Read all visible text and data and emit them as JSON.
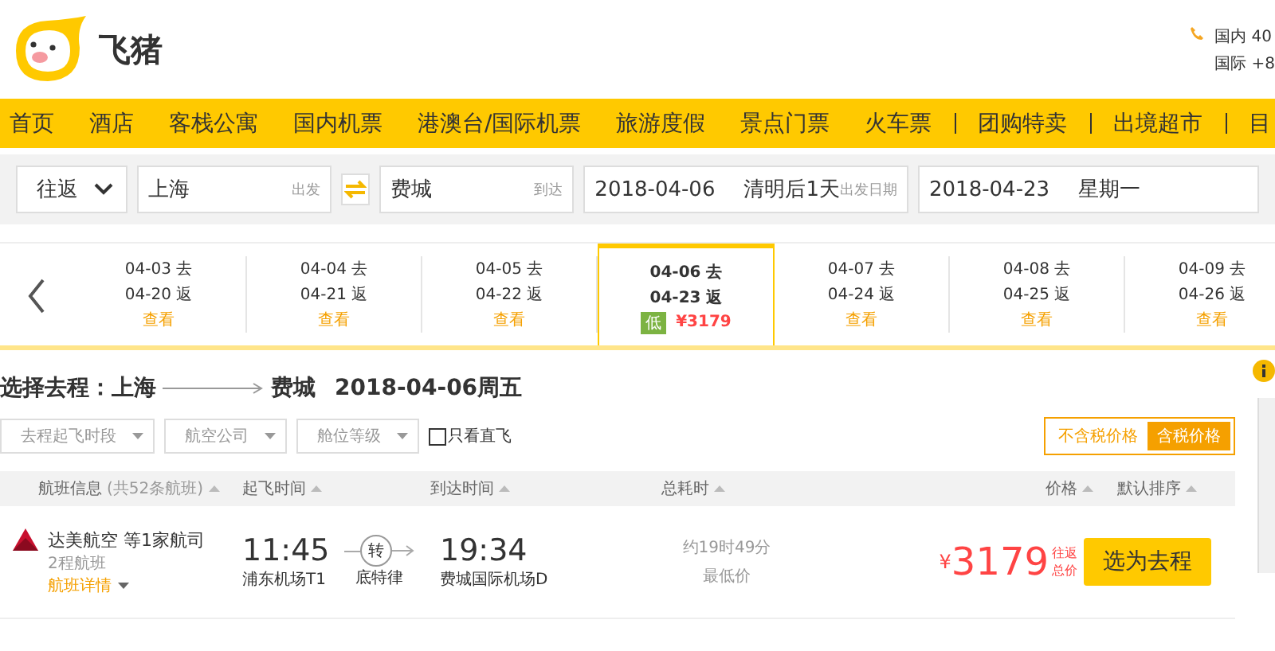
{
  "brand": {
    "name": "飞猪"
  },
  "hotline": [
    "国内 40",
    "国际 +8"
  ],
  "nav": [
    "首页",
    "酒店",
    "客栈公寓",
    "国内机票",
    "港澳台/国际机票",
    "旅游度假",
    "景点门票",
    "火车票",
    "团购特卖",
    "出境超市",
    "目"
  ],
  "search": {
    "trip_type": "往返",
    "from": "上海",
    "from_hint": "出发",
    "to": "费城",
    "to_hint": "到达",
    "depart_date": "2018-04-06",
    "depart_note": "清明后1天",
    "depart_hint": "出发日期",
    "return_date": "2018-04-23",
    "return_note": "星期一"
  },
  "dates": [
    {
      "go": "04-03 去",
      "back": "04-20 返",
      "link": "查看",
      "selected": false
    },
    {
      "go": "04-04 去",
      "back": "04-21 返",
      "link": "查看",
      "selected": false
    },
    {
      "go": "04-05 去",
      "back": "04-22 返",
      "link": "查看",
      "selected": false
    },
    {
      "go": "04-06 去",
      "back": "04-23 返",
      "badge": "低",
      "price": "¥3179",
      "selected": true
    },
    {
      "go": "04-07 去",
      "back": "04-24 返",
      "link": "查看",
      "selected": false
    },
    {
      "go": "04-08 去",
      "back": "04-25 返",
      "link": "查看",
      "selected": false
    },
    {
      "go": "04-09 去",
      "back": "04-26 返",
      "link": "查看",
      "selected": false
    }
  ],
  "heading": {
    "label": "选择去程：",
    "from": "上海",
    "to": "费城",
    "date": "2018-04-06周五"
  },
  "filters": [
    "去程起飞时段",
    "航空公司",
    "舱位等级"
  ],
  "direct_only": {
    "label": "只看直飞",
    "checked": false
  },
  "price_toggle": [
    {
      "label": "不含税价格",
      "selected": false
    },
    {
      "label": "含税价格",
      "selected": true
    }
  ],
  "columns": [
    {
      "label": "航班信息",
      "note": "(共52条航班)"
    },
    {
      "label": "起飞时间"
    },
    {
      "label": "到达时间"
    },
    {
      "label": "总耗时"
    },
    {
      "label": "价格"
    },
    {
      "label": "默认排序"
    }
  ],
  "flights": [
    {
      "airline": "达美航空 等1家航司",
      "legs": "2程航班",
      "details": "航班详情",
      "depart_time": "11:45",
      "depart_airport": "浦东机场T1",
      "transfer": "转",
      "transfer_city": "底特律",
      "arrive_time": "19:34",
      "arrive_airport": "费城国际机场D",
      "duration": "约19时49分",
      "tag": "最低价",
      "currency": "¥",
      "price": "3179",
      "price_note": [
        "往返",
        "总价"
      ],
      "action": "选为去程"
    }
  ]
}
